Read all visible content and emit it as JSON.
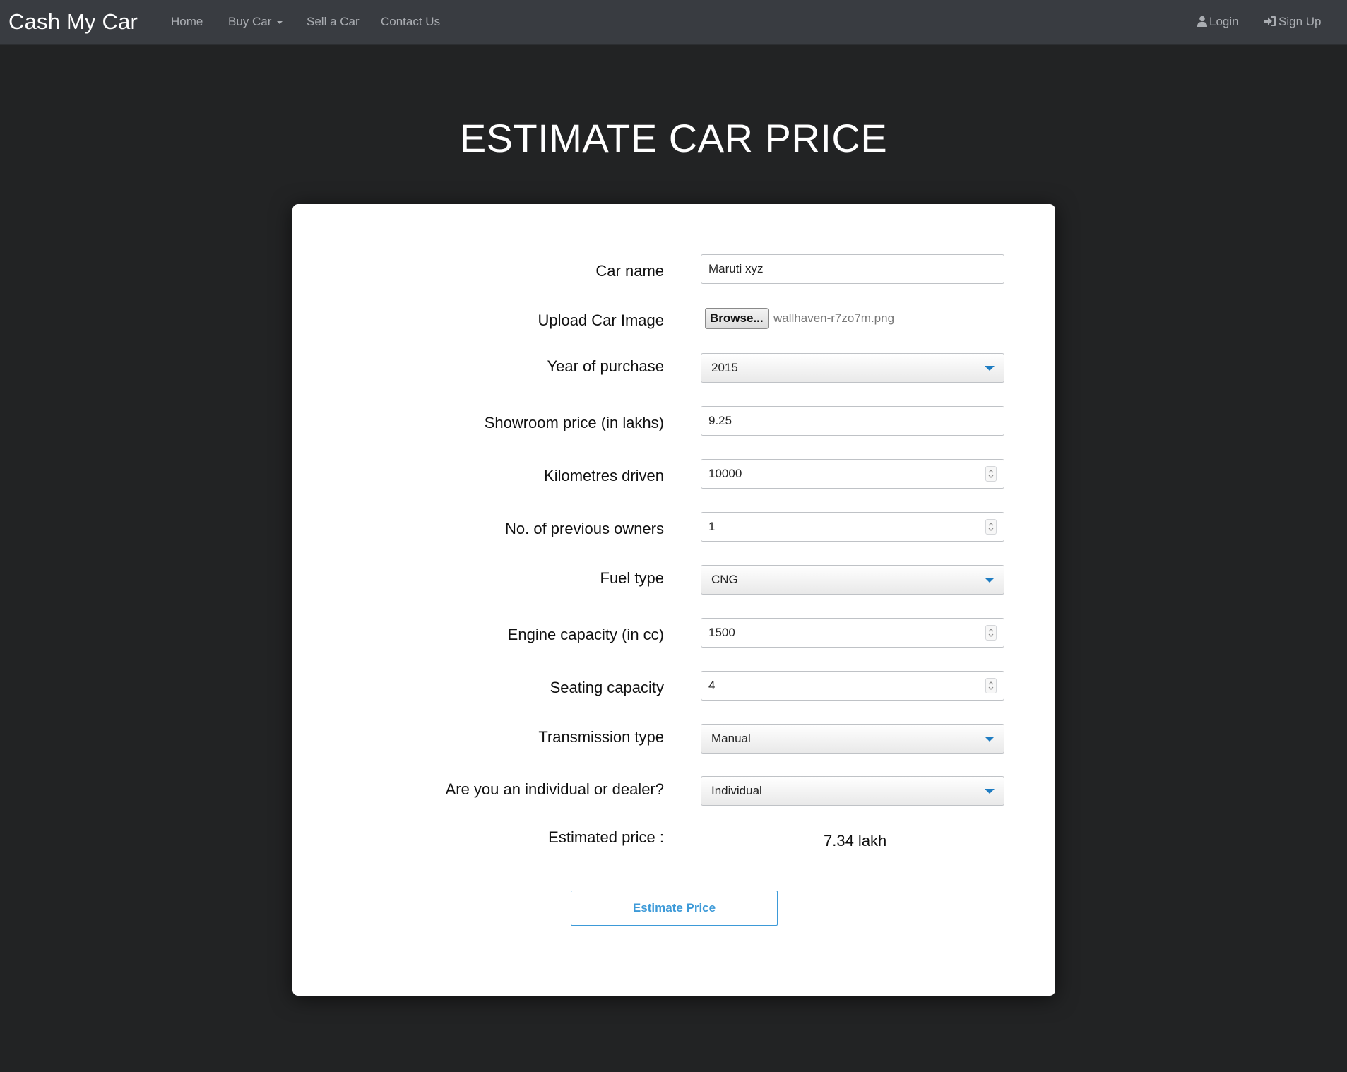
{
  "nav": {
    "brand": "Cash My Car",
    "links": {
      "home": "Home",
      "buy_car": "Buy Car",
      "sell_car": "Sell a Car",
      "contact": "Contact Us",
      "login": "Login",
      "signup": "Sign Up"
    }
  },
  "page": {
    "title": "ESTIMATE CAR PRICE"
  },
  "form": {
    "car_name": {
      "label": "Car name",
      "value": "Maruti xyz"
    },
    "upload": {
      "label": "Upload Car Image",
      "button": "Browse...",
      "file_name": "wallhaven-r7zo7m.png"
    },
    "year": {
      "label": "Year of purchase",
      "value": "2015"
    },
    "showroom_price": {
      "label": "Showroom price (in lakhs)",
      "value": "9.25"
    },
    "kms_driven": {
      "label": "Kilometres driven",
      "value": "10000"
    },
    "owners": {
      "label": "No. of previous owners",
      "value": "1"
    },
    "fuel_type": {
      "label": "Fuel type",
      "value": "CNG"
    },
    "engine": {
      "label": "Engine capacity (in cc)",
      "value": "1500"
    },
    "seats": {
      "label": "Seating capacity",
      "value": "4"
    },
    "transmission": {
      "label": "Transmission type",
      "value": "Manual"
    },
    "seller_type": {
      "label": "Are you an individual or dealer?",
      "value": "Individual"
    },
    "estimated_price": {
      "label": "Estimated price :",
      "value": "7.34 lakh"
    },
    "submit": "Estimate Price"
  },
  "colors": {
    "background": "#222324",
    "navbar": "#393c41",
    "accent": "#3d9ad8",
    "select_arrow": "#1e7cc2"
  },
  "icons": {
    "login": "user-icon",
    "signup": "sign-in-icon"
  }
}
